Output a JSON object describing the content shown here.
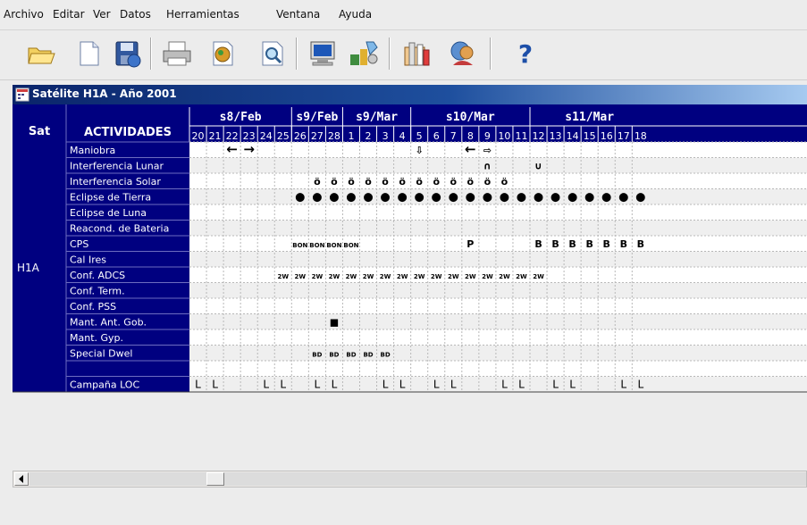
{
  "menu": [
    "Archivo",
    "Editar",
    "Ver",
    "Datos",
    "Herramientas",
    "Ventana",
    "Ayuda"
  ],
  "toolbar": {
    "items": [
      "open-folder",
      "new-document",
      "save",
      "print",
      "export",
      "preview",
      "monitor",
      "tools",
      "settings",
      "user",
      "help"
    ],
    "help_glyph": "?"
  },
  "window": {
    "title": "Satélite H1A - Año 2001"
  },
  "table": {
    "sat_header": "Sat",
    "activities_header": "ACTIVIDADES",
    "sat_label": "H1A",
    "weeks": [
      {
        "label": "s8/Feb",
        "span": 6
      },
      {
        "label": "s9/Feb",
        "span": 3
      },
      {
        "label": "s9/Mar",
        "span": 4
      },
      {
        "label": "s10/Mar",
        "span": 7
      },
      {
        "label": "s11/Mar",
        "span": 7
      }
    ],
    "days": [
      "20",
      "21",
      "22",
      "23",
      "24",
      "25",
      "26",
      "27",
      "28",
      "1",
      "2",
      "3",
      "4",
      "5",
      "6",
      "7",
      "8",
      "9",
      "10",
      "11",
      "12",
      "13",
      "14",
      "15",
      "16",
      "17",
      "18"
    ],
    "activities": [
      "Maniobra",
      "Interferencia Lunar",
      "Interferencia Solar",
      "Eclipse de Tierra",
      "Eclipse de Luna",
      "Reacond. de Bateria",
      "CPS",
      "Cal Ires",
      "Conf. ADCS",
      "Conf. Term.",
      "Conf. PSS",
      "Mant. Ant. Gob.",
      "Mant. Gyp.",
      "Special Dwel",
      "",
      "Campaña LOC"
    ],
    "marks": {
      "Maniobra": [
        {
          "day": 2,
          "t": "←"
        },
        {
          "day": 3,
          "t": "→"
        },
        {
          "day": 13,
          "t": "⇩"
        },
        {
          "day": 16,
          "t": "←"
        },
        {
          "day": 17,
          "t": "⇨"
        }
      ],
      "Interferencia Lunar": [
        {
          "day": 17,
          "t": "∩"
        },
        {
          "day": 20,
          "t": "∪"
        }
      ],
      "Interferencia Solar": [
        {
          "day": 7,
          "t": "ö"
        },
        {
          "day": 8,
          "t": "ö"
        },
        {
          "day": 9,
          "t": "ö"
        },
        {
          "day": 10,
          "t": "ö"
        },
        {
          "day": 11,
          "t": "ö"
        },
        {
          "day": 12,
          "t": "ö"
        },
        {
          "day": 13,
          "t": "ö"
        },
        {
          "day": 14,
          "t": "ö"
        },
        {
          "day": 15,
          "t": "ö"
        },
        {
          "day": 16,
          "t": "ö"
        },
        {
          "day": 17,
          "t": "ö"
        },
        {
          "day": 18,
          "t": "ö"
        }
      ],
      "Eclipse de Tierra": [
        {
          "day": 6,
          "t": "●"
        },
        {
          "day": 7,
          "t": "●"
        },
        {
          "day": 8,
          "t": "●"
        },
        {
          "day": 9,
          "t": "●"
        },
        {
          "day": 10,
          "t": "●"
        },
        {
          "day": 11,
          "t": "●"
        },
        {
          "day": 12,
          "t": "●"
        },
        {
          "day": 13,
          "t": "●"
        },
        {
          "day": 14,
          "t": "●"
        },
        {
          "day": 15,
          "t": "●"
        },
        {
          "day": 16,
          "t": "●"
        },
        {
          "day": 17,
          "t": "●"
        },
        {
          "day": 18,
          "t": "●"
        },
        {
          "day": 19,
          "t": "●"
        },
        {
          "day": 20,
          "t": "●"
        },
        {
          "day": 21,
          "t": "●"
        },
        {
          "day": 22,
          "t": "●"
        },
        {
          "day": 23,
          "t": "●"
        },
        {
          "day": 24,
          "t": "●"
        },
        {
          "day": 25,
          "t": "●"
        },
        {
          "day": 26,
          "t": "●"
        }
      ],
      "CPS": [
        {
          "day": 6,
          "t": "BON"
        },
        {
          "day": 7,
          "t": "BON"
        },
        {
          "day": 8,
          "t": "BON"
        },
        {
          "day": 9,
          "t": "BON"
        },
        {
          "day": 16,
          "t": "P"
        },
        {
          "day": 20,
          "t": "B"
        },
        {
          "day": 21,
          "t": "B"
        },
        {
          "day": 22,
          "t": "B"
        },
        {
          "day": 23,
          "t": "B"
        },
        {
          "day": 24,
          "t": "B"
        },
        {
          "day": 25,
          "t": "B"
        },
        {
          "day": 26,
          "t": "B"
        }
      ],
      "Conf. ADCS": [
        {
          "day": 5,
          "t": "2W"
        },
        {
          "day": 6,
          "t": "2W"
        },
        {
          "day": 7,
          "t": "2W"
        },
        {
          "day": 8,
          "t": "2W"
        },
        {
          "day": 9,
          "t": "2W"
        },
        {
          "day": 10,
          "t": "2W"
        },
        {
          "day": 11,
          "t": "2W"
        },
        {
          "day": 12,
          "t": "2W"
        },
        {
          "day": 13,
          "t": "2W"
        },
        {
          "day": 14,
          "t": "2W"
        },
        {
          "day": 15,
          "t": "2W"
        },
        {
          "day": 16,
          "t": "2W"
        },
        {
          "day": 17,
          "t": "2W"
        },
        {
          "day": 18,
          "t": "2W"
        },
        {
          "day": 19,
          "t": "2W"
        },
        {
          "day": 20,
          "t": "2W"
        }
      ],
      "Mant. Ant. Gob.": [
        {
          "day": 8,
          "t": "■"
        }
      ],
      "Special Dwel": [
        {
          "day": 7,
          "t": "BD"
        },
        {
          "day": 8,
          "t": "BD"
        },
        {
          "day": 9,
          "t": "BD"
        },
        {
          "day": 10,
          "t": "BD"
        },
        {
          "day": 11,
          "t": "BD"
        }
      ],
      "Campaña LOC": [
        {
          "day": 0,
          "t": "L"
        },
        {
          "day": 1,
          "t": "L"
        },
        {
          "day": 4,
          "t": "L"
        },
        {
          "day": 5,
          "t": "L"
        },
        {
          "day": 7,
          "t": "L"
        },
        {
          "day": 8,
          "t": "L"
        },
        {
          "day": 11,
          "t": "L"
        },
        {
          "day": 12,
          "t": "L"
        },
        {
          "day": 14,
          "t": "L"
        },
        {
          "day": 15,
          "t": "L"
        },
        {
          "day": 18,
          "t": "L"
        },
        {
          "day": 19,
          "t": "L"
        },
        {
          "day": 21,
          "t": "L"
        },
        {
          "day": 22,
          "t": "L"
        },
        {
          "day": 25,
          "t": "L"
        },
        {
          "day": 26,
          "t": "L"
        }
      ]
    }
  },
  "colors": {
    "navy": "#000080",
    "white": "#ffffff",
    "grid": "#b8b8b8",
    "row_alt": "#efefef",
    "week_line": "#0000aa"
  }
}
